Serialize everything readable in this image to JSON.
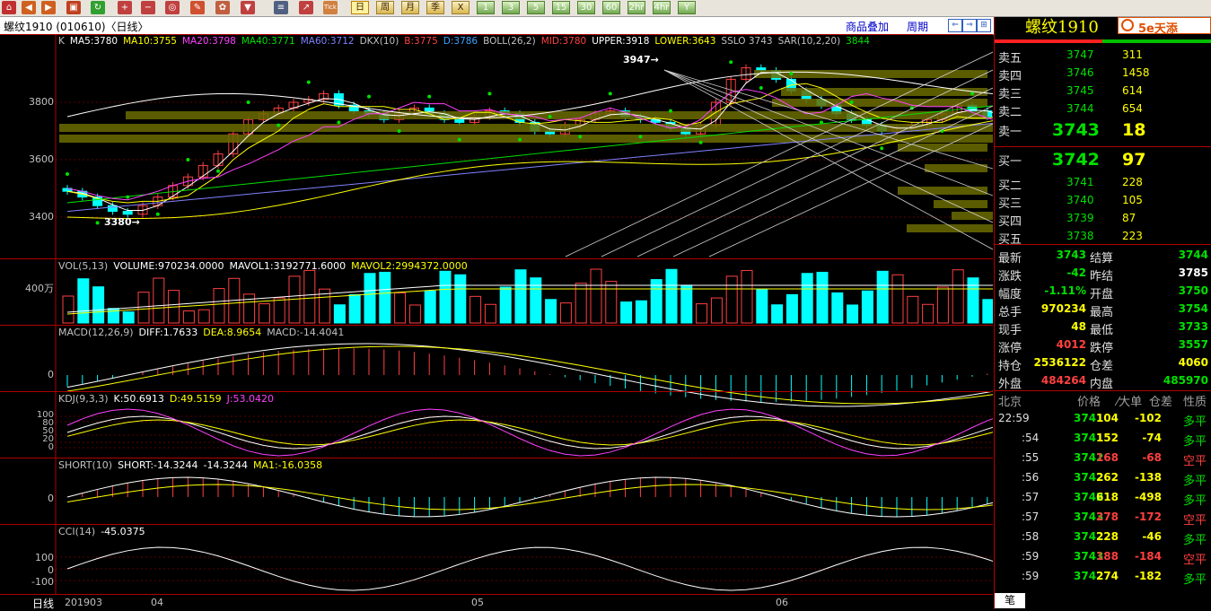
{
  "toolbar": {
    "icons": [
      "home-icon",
      "back-icon",
      "forward-icon",
      "refresh-icon",
      "zoom-in-icon",
      "zoom-out-icon",
      "draw-icon",
      "pen-icon",
      "brush-icon",
      "filter-icon",
      "list-icon",
      "chart-icon",
      "tick-icon"
    ],
    "tick_label": "Tick",
    "periods": [
      {
        "label": "日",
        "selected": true
      },
      {
        "label": "周",
        "selected": false
      },
      {
        "label": "月",
        "selected": false
      },
      {
        "label": "季",
        "selected": false
      },
      {
        "label": "X",
        "selected": false
      },
      {
        "label": "1",
        "selected": false
      },
      {
        "label": "3",
        "selected": false
      },
      {
        "label": "5",
        "selected": false
      },
      {
        "label": "15",
        "selected": false
      },
      {
        "label": "30",
        "selected": false
      },
      {
        "label": "60",
        "selected": false
      },
      {
        "label": "2hr",
        "selected": false
      },
      {
        "label": "4hr",
        "selected": false
      },
      {
        "label": "Y",
        "selected": false
      }
    ]
  },
  "title": {
    "instrument": "螺纹1910 (010610)〈日线〉",
    "overlay_link": "商品叠加",
    "period_link": "周期"
  },
  "main_header": {
    "k": "K",
    "ma5": "MA5:3780",
    "ma10": "MA10:3755",
    "ma20": "MA20:3798",
    "ma40": "MA40:3771",
    "ma60": "MA60:3712",
    "dkx": "DKX(10)",
    "dkx_b": "B:3775",
    "dkx_d": "D:3786",
    "boll": "BOLL(26,2)",
    "mid": "MID:3780",
    "upper": "UPPER:3918",
    "lower": "LOWER:3643",
    "sslo": "SSLO  3743",
    "sar": "SAR(10,2,20)",
    "sar_val": "3844"
  },
  "price_axis": [
    "3800",
    "3600",
    "3400"
  ],
  "annotations": {
    "high": "3947",
    "low": "3380"
  },
  "vol_header": {
    "vol": "VOL(5,13)",
    "volume": "VOLUME:970234.0000",
    "mavol1": "MAVOL1:3192771.6000",
    "mavol2": "MAVOL2:2994372.0000"
  },
  "vol_axis": "400万",
  "macd_header": {
    "macd": "MACD(12,26,9)",
    "diff": "DIFF:1.7633",
    "dea": "DEA:8.9654",
    "macdv": "MACD:-14.4041"
  },
  "macd_axis": "0",
  "kdj_header": {
    "kdj": "KDJ(9,3,3)",
    "k": "K:50.6913",
    "d": "D:49.5159",
    "j": "J:53.0420"
  },
  "kdj_axis": [
    "100",
    "80",
    "50",
    "20",
    "0"
  ],
  "short_header": {
    "short": "SHORT(10)",
    "shortv": "SHORT:-14.3244",
    "shortv2": "-14.3244",
    "ma1": "MA1:-16.0358"
  },
  "short_axis": "0",
  "cci_header": {
    "cci": "CCI(14)",
    "val": "-45.0375"
  },
  "cci_axis": [
    "100",
    "0",
    "-100"
  ],
  "bottom": {
    "period": "日线",
    "dates": [
      "201903",
      "04",
      "05",
      "06"
    ]
  },
  "right_panel": {
    "title": "螺纹1910",
    "logo_text": "5e天添",
    "asks": [
      {
        "label": "卖五",
        "price": "3747",
        "vol": "311"
      },
      {
        "label": "卖四",
        "price": "3746",
        "vol": "1458"
      },
      {
        "label": "卖三",
        "price": "3745",
        "vol": "614"
      },
      {
        "label": "卖二",
        "price": "3744",
        "vol": "654"
      },
      {
        "label": "卖一",
        "price": "3743",
        "vol": "18"
      }
    ],
    "bids": [
      {
        "label": "买一",
        "price": "3742",
        "vol": "97"
      },
      {
        "label": "买二",
        "price": "3741",
        "vol": "228"
      },
      {
        "label": "买三",
        "price": "3740",
        "vol": "105"
      },
      {
        "label": "买四",
        "price": "3739",
        "vol": "87"
      },
      {
        "label": "买五",
        "price": "3738",
        "vol": "223"
      }
    ],
    "stats": [
      {
        "l1": "最新",
        "v1": "3743",
        "c1": "dn",
        "l2": "结算",
        "v2": "3744",
        "c2": "dn"
      },
      {
        "l1": "涨跌",
        "v1": "-42",
        "c1": "dn",
        "l2": "昨结",
        "v2": "3785",
        "c2": "wht"
      },
      {
        "l1": "幅度",
        "v1": "-1.11%",
        "c1": "dn",
        "l2": "开盘",
        "v2": "3750",
        "c2": "dn"
      },
      {
        "l1": "总手",
        "v1": "970234",
        "c1": "yel",
        "l2": "最高",
        "v2": "3754",
        "c2": "dn"
      },
      {
        "l1": "现手",
        "v1": "48",
        "c1": "yel",
        "l2": "最低",
        "v2": "3733",
        "c2": "dn"
      },
      {
        "l1": "涨停",
        "v1": "4012",
        "c1": "up",
        "l2": "跌停",
        "v2": "3557",
        "c2": "dn"
      },
      {
        "l1": "持仓",
        "v1": "2536122",
        "c1": "yel",
        "l2": "仓差",
        "v2": "4060",
        "c2": "yel"
      },
      {
        "l1": "外盘",
        "v1": "484264",
        "c1": "up",
        "l2": "内盘",
        "v2": "485970",
        "c2": "dn"
      }
    ],
    "tick_header": {
      "time": "北京",
      "price": "价格",
      "big": "⁄大单",
      "pos": "仓差",
      "nature": "性质"
    },
    "ticks": [
      {
        "time": "22:59",
        "price": "3741",
        "vol": "104",
        "pos": "-102",
        "nature": "多平",
        "pc": "dn",
        "vc": "yel",
        "nc": "dn"
      },
      {
        "time": ":54",
        "price": "3741",
        "vol": "152",
        "pos": "-74",
        "nature": "多平",
        "pc": "dn",
        "vc": "yel",
        "nc": "dn"
      },
      {
        "time": ":55",
        "price": "3742",
        "vol": "168",
        "pos": "-68",
        "nature": "空平",
        "pc": "dn",
        "vc": "up",
        "nc": "up"
      },
      {
        "time": ":56",
        "price": "3742",
        "vol": "262",
        "pos": "-138",
        "nature": "多平",
        "pc": "dn",
        "vc": "yel",
        "nc": "dn"
      },
      {
        "time": ":57",
        "price": "3742",
        "vol": "618",
        "pos": "-498",
        "nature": "多平",
        "pc": "dn",
        "vc": "yel",
        "nc": "dn"
      },
      {
        "time": ":57",
        "price": "3743",
        "vol": "278",
        "pos": "-172",
        "nature": "空平",
        "pc": "dn",
        "vc": "up",
        "nc": "up"
      },
      {
        "time": ":58",
        "price": "3742",
        "vol": "228",
        "pos": "-46",
        "nature": "多平",
        "pc": "dn",
        "vc": "yel",
        "nc": "dn"
      },
      {
        "time": ":59",
        "price": "3743",
        "vol": "188",
        "pos": "-184",
        "nature": "空平",
        "pc": "dn",
        "vc": "up",
        "nc": "up"
      },
      {
        "time": ":59",
        "price": "3742",
        "vol": "274",
        "pos": "-182",
        "nature": "多平",
        "pc": "dn",
        "vc": "yel",
        "nc": "dn"
      }
    ],
    "bottom_tab": "笔"
  },
  "colors": {
    "up": "#ff4040",
    "down": "#00ffff",
    "bg": "#000000",
    "grid": "#b00000"
  }
}
